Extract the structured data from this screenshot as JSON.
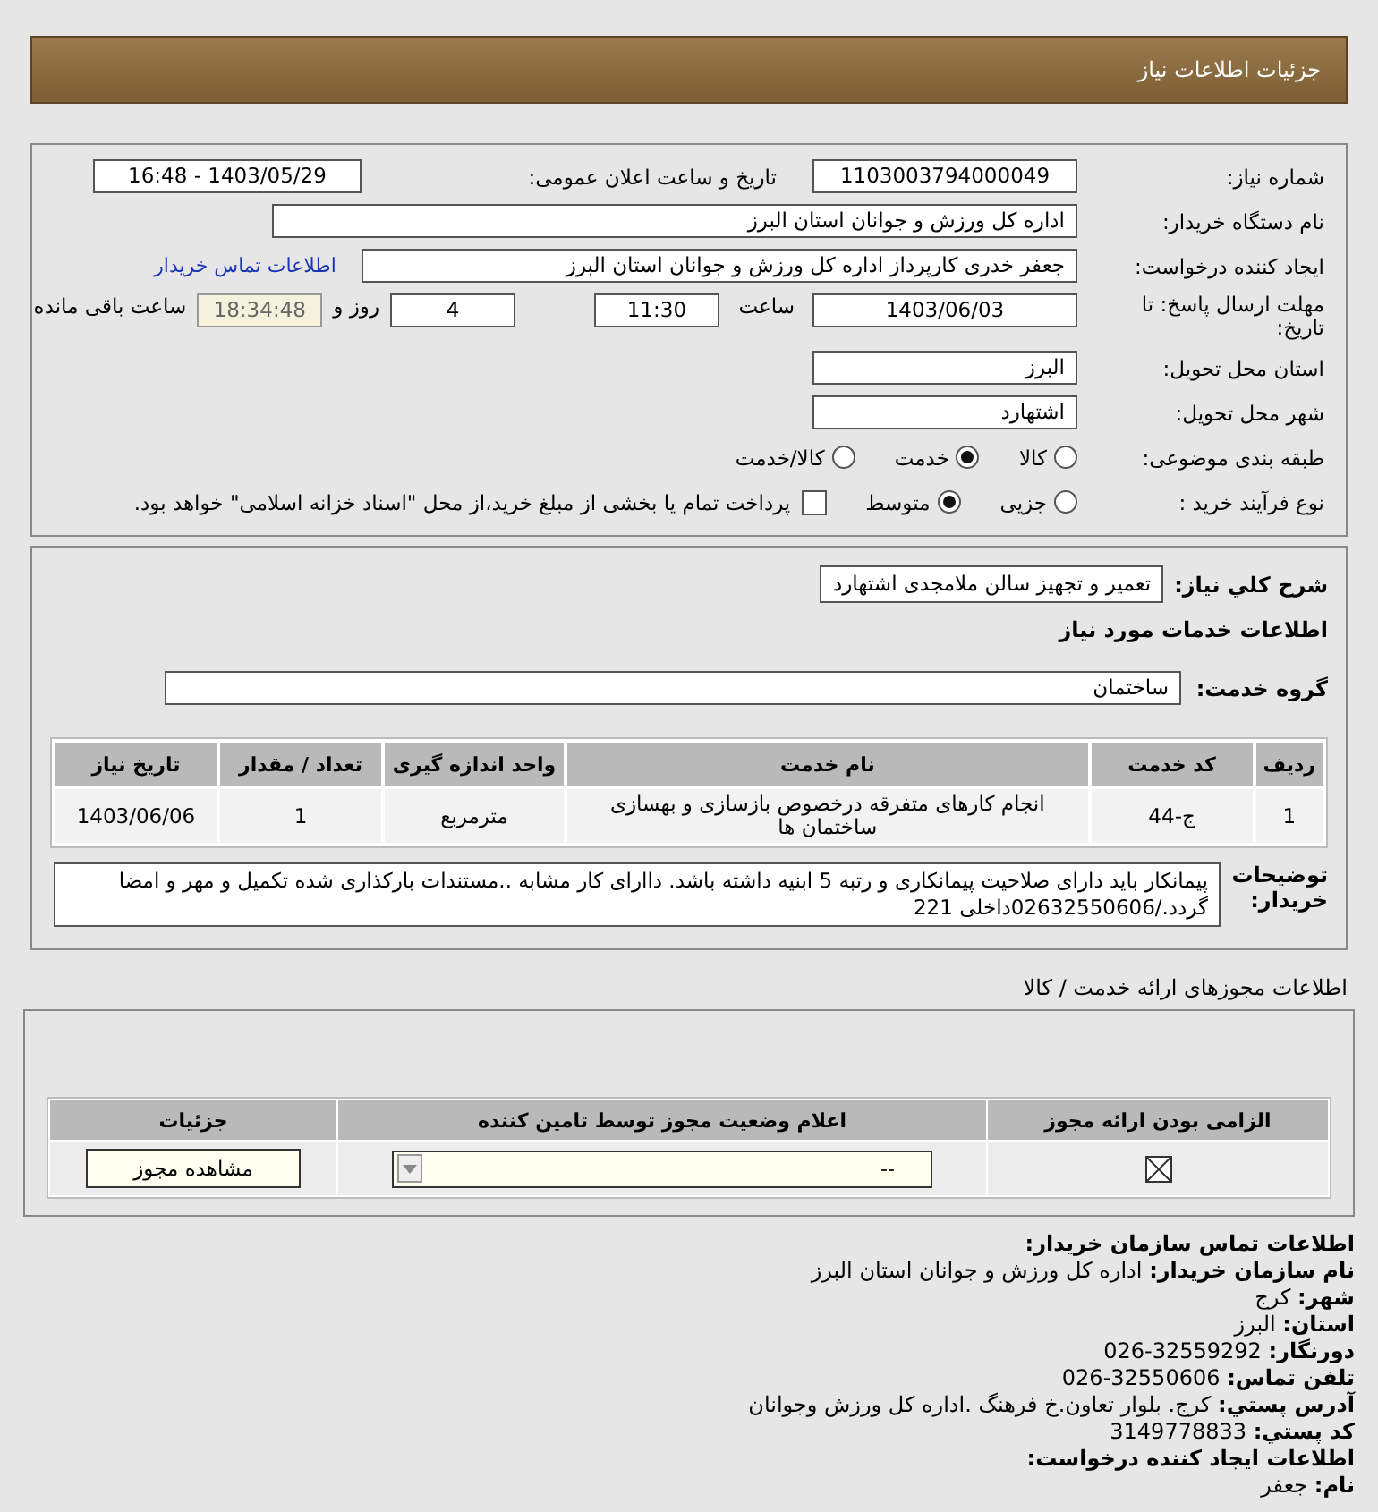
{
  "header": {
    "title": "جزئیات اطلاعات نیاز"
  },
  "form": {
    "need_number": {
      "label": "شماره نیاز:",
      "value": "1103003794000049"
    },
    "announce": {
      "label": "تاریخ و ساعت اعلان عمومی:",
      "value": "1403/05/29 - 16:48"
    },
    "buyer_org": {
      "label": "نام دستگاه خریدار:",
      "value": "اداره کل ورزش و جوانان استان البرز"
    },
    "requester": {
      "label": "ایجاد کننده درخواست:",
      "value": "جعفر خدری کارپرداز اداره کل ورزش و جوانان استان البرز",
      "link": "اطلاعات تماس خریدار"
    },
    "deadline": {
      "label": "مهلت ارسال پاسخ: تا تاریخ:",
      "date": "1403/06/03",
      "time_label": "ساعت",
      "time": "11:30",
      "days": "4",
      "days_label": "روز و",
      "remaining": "18:34:48",
      "remaining_label": "ساعت باقی مانده"
    },
    "province": {
      "label": "استان محل تحویل:",
      "value": "البرز"
    },
    "city": {
      "label": "شهر محل تحویل:",
      "value": "اشتهارد"
    },
    "category": {
      "label": "طبقه بندی موضوعی:",
      "options": [
        {
          "label": "کالا",
          "selected": false
        },
        {
          "label": "خدمت",
          "selected": true
        },
        {
          "label": "کالا/خدمت",
          "selected": false
        }
      ]
    },
    "process": {
      "label": "نوع فرآیند خرید :",
      "options": [
        {
          "label": "جزیی",
          "selected": false
        },
        {
          "label": "متوسط",
          "selected": true
        }
      ],
      "treasury": {
        "checked": false,
        "label": "پرداخت تمام یا بخشی از مبلغ خرید،از محل \"اسناد خزانه اسلامی\" خواهد بود."
      }
    }
  },
  "services": {
    "summary": {
      "label": "شرح کلي نياز:",
      "value": "تعمیر و تجهیز سالن ملامجدی اشتهارد"
    },
    "heading": "اطلاعات خدمات مورد نیاز",
    "group": {
      "label": "گروه خدمت:",
      "value": "ساختمان"
    },
    "table": {
      "columns": [
        "ردیف",
        "کد خدمت",
        "نام خدمت",
        "واحد اندازه گیری",
        "تعداد / مقدار",
        "تاریخ نیاز"
      ],
      "rows": [
        [
          "1",
          "ج-44",
          "انجام کارهای متفرقه درخصوص بازسازی و بهسازی ساختمان ها",
          "مترمربع",
          "1",
          "1403/06/06"
        ]
      ]
    },
    "notes": {
      "label": "توضیحات خریدار:",
      "value": "پیمانکار باید دارای صلاحیت پیمانکاری و رتبه 5 ابنیه داشته باشد. داارای کار مشابه ..مستندات بارکذاری شده تکمیل و مهر و امضا گردد./02632550606داخلی 221"
    }
  },
  "permits": {
    "title": "اطلاعات مجوزهای ارائه خدمت / کالا",
    "columns": [
      "الزامی بودن ارائه مجوز",
      "اعلام وضعیت مجوز توسط تامین کننده",
      "جزئیات"
    ],
    "rows": [
      {
        "required": true,
        "status": "--",
        "button": "مشاهده مجوز"
      }
    ]
  },
  "contact": [
    {
      "kind": "heading",
      "text": "اطلاعات تماس سازمان خریدار:"
    },
    {
      "kind": "line",
      "label": "نام سازمان خریدار:",
      "value": "اداره کل ورزش و جوانان استان البرز"
    },
    {
      "kind": "line",
      "label": "شهر:",
      "value": "کرج"
    },
    {
      "kind": "line",
      "label": "استان:",
      "value": "البرز"
    },
    {
      "kind": "line",
      "label": "دورنگار:",
      "value": "32559292-026"
    },
    {
      "kind": "line",
      "label": "تلفن تماس:",
      "value": "32550606-026"
    },
    {
      "kind": "line",
      "label": "آدرس پستي:",
      "value": "کرج. بلوار تعاون.خ فرهنگ .اداره کل ورزش وجوانان"
    },
    {
      "kind": "line",
      "label": "کد پستي:",
      "value": "3149778833"
    },
    {
      "kind": "heading",
      "text": "اطلاعات ایجاد کننده درخواست:"
    },
    {
      "kind": "line",
      "label": "نام:",
      "value": "جعفر"
    }
  ]
}
